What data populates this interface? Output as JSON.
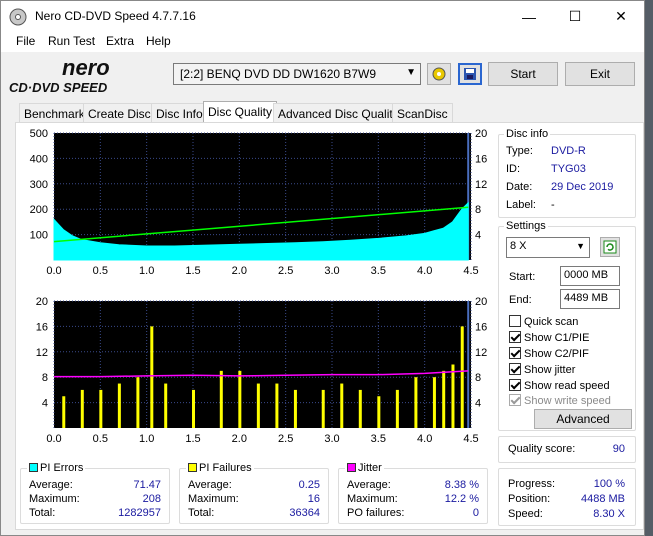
{
  "window": {
    "title": "Nero CD-DVD Speed 4.7.7.16",
    "minimize": "—",
    "maximize": "☐",
    "close": "✕"
  },
  "menu": [
    "File",
    "Run Test",
    "Extra",
    "Help"
  ],
  "logo": {
    "line1": "nero",
    "line2": "CD·DVD SPEED"
  },
  "toolbar": {
    "drive": "[2:2]   BENQ DVD DD DW1620 B7W9",
    "start": "Start",
    "exit": "Exit"
  },
  "tabs": [
    "Benchmark",
    "Create Disc",
    "Disc Info",
    "Disc Quality",
    "Advanced Disc Quality",
    "ScanDisc"
  ],
  "active_tab": "Disc Quality",
  "disc_info": {
    "title": "Disc info",
    "type_label": "Type:",
    "type": "DVD-R",
    "id_label": "ID:",
    "id": "TYG03",
    "date_label": "Date:",
    "date": "29 Dec 2019",
    "label_label": "Label:",
    "label": "-"
  },
  "settings": {
    "title": "Settings",
    "speed": "8 X",
    "start_label": "Start:",
    "start": "0000 MB",
    "end_label": "End:",
    "end": "4489 MB",
    "quick_scan": "Quick scan",
    "show_c1pie": "Show C1/PIE",
    "show_c2pif": "Show C2/PIF",
    "show_jitter": "Show jitter",
    "show_read_speed": "Show read speed",
    "show_write_speed": "Show write speed",
    "advanced": "Advanced"
  },
  "quality": {
    "label": "Quality score:",
    "value": "90"
  },
  "progress": {
    "progress_label": "Progress:",
    "progress": "100 %",
    "position_label": "Position:",
    "position": "4488 MB",
    "speed_label": "Speed:",
    "speed": "8.30 X"
  },
  "pi_errors": {
    "title": "PI Errors",
    "color": "#00ffff",
    "avg_label": "Average:",
    "avg": "71.47",
    "max_label": "Maximum:",
    "max": "208",
    "total_label": "Total:",
    "total": "1282957"
  },
  "pi_failures": {
    "title": "PI Failures",
    "color": "#ffff00",
    "avg_label": "Average:",
    "avg": "0.25",
    "max_label": "Maximum:",
    "max": "16",
    "total_label": "Total:",
    "total": "36364"
  },
  "jitter": {
    "title": "Jitter",
    "color": "#ff00ff",
    "avg_label": "Average:",
    "avg": "8.38 %",
    "max_label": "Maximum:",
    "max": "12.2 %",
    "po_label": "PO failures:",
    "po": "0"
  },
  "chart_data": [
    {
      "type": "area",
      "name": "PI Errors",
      "x_ticks": [
        "0.0",
        "0.5",
        "1.0",
        "1.5",
        "2.0",
        "2.5",
        "3.0",
        "3.5",
        "4.0",
        "4.5"
      ],
      "y_left_ticks": [
        "500",
        "400",
        "300",
        "200",
        "100"
      ],
      "y_right_ticks": [
        "20",
        "16",
        "12",
        "8",
        "4"
      ],
      "xlim": [
        0,
        4.5
      ],
      "ylim": [
        0,
        500
      ],
      "y2lim": [
        0,
        20
      ],
      "grid": true,
      "series": [
        {
          "name": "PI Errors",
          "color": "#00ffff",
          "x": [
            0.0,
            0.05,
            0.1,
            0.2,
            0.3,
            0.5,
            0.7,
            1.0,
            1.3,
            1.6,
            2.0,
            2.3,
            2.6,
            2.9,
            3.2,
            3.5,
            3.8,
            4.0,
            4.1,
            4.2,
            4.3,
            4.35,
            4.4,
            4.47
          ],
          "values": [
            160,
            140,
            120,
            95,
            80,
            68,
            60,
            55,
            55,
            58,
            62,
            65,
            68,
            72,
            78,
            85,
            95,
            105,
            115,
            125,
            150,
            175,
            200,
            225
          ]
        },
        {
          "name": "Read speed",
          "color": "#00ff00",
          "axis": "right",
          "x": [
            0.0,
            4.47
          ],
          "values": [
            2.9,
            8.3
          ]
        }
      ]
    },
    {
      "type": "bar",
      "name": "PI Failures",
      "x_ticks": [
        "0.0",
        "0.5",
        "1.0",
        "1.5",
        "2.0",
        "2.5",
        "3.0",
        "3.5",
        "4.0",
        "4.5"
      ],
      "y_left_ticks": [
        "20",
        "16",
        "12",
        "8",
        "4"
      ],
      "y_right_ticks": [
        "20",
        "16",
        "12",
        "8",
        "4"
      ],
      "xlim": [
        0,
        4.5
      ],
      "ylim": [
        0,
        20
      ],
      "y2lim": [
        0,
        20
      ],
      "grid": true,
      "series": [
        {
          "name": "PI Failures",
          "color": "#ffff00",
          "x": [
            0.1,
            0.3,
            0.5,
            0.7,
            0.9,
            1.05,
            1.2,
            1.5,
            1.8,
            2.0,
            2.2,
            2.4,
            2.6,
            2.9,
            3.1,
            3.3,
            3.5,
            3.7,
            3.9,
            4.1,
            4.2,
            4.3,
            4.4
          ],
          "values": [
            5,
            6,
            6,
            7,
            8,
            16,
            7,
            6,
            9,
            9,
            7,
            7,
            6,
            6,
            7,
            6,
            5,
            6,
            8,
            8,
            9,
            10,
            16
          ]
        },
        {
          "name": "Jitter",
          "color": "#ff00ff",
          "axis": "right",
          "x": [
            0.0,
            0.5,
            1.0,
            1.5,
            2.0,
            2.5,
            3.0,
            3.5,
            4.0,
            4.47
          ],
          "values": [
            8.1,
            8.1,
            8.2,
            8.3,
            8.2,
            8.3,
            8.4,
            8.4,
            8.6,
            9.0
          ]
        }
      ]
    }
  ]
}
